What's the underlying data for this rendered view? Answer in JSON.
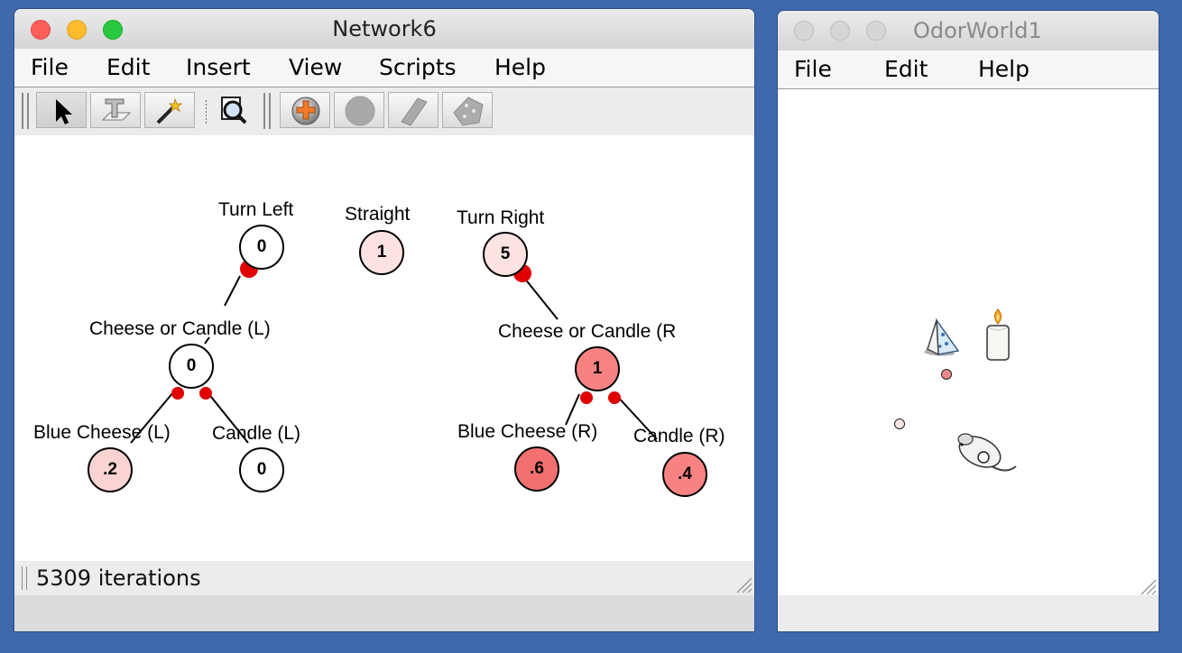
{
  "network_window": {
    "title": "Network6",
    "menu": [
      "File",
      "Edit",
      "Insert",
      "View",
      "Scripts",
      "Help"
    ],
    "toolbar": [
      "select-arrow-icon",
      "text-tool-icon",
      "wand-icon",
      "zoom-icon",
      "add-neuron-icon",
      "neuron-icon",
      "eraser-icon",
      "dice-icon"
    ],
    "neurons": [
      {
        "id": "turn-left",
        "label": "Turn Left",
        "value": "0",
        "color": "#ffffff"
      },
      {
        "id": "straight",
        "label": "Straight",
        "value": "1",
        "color": "#fde2e2"
      },
      {
        "id": "turn-right",
        "label": "Turn Right",
        "value": "5",
        "color": "#fde2e2"
      },
      {
        "id": "cheese-candle-left",
        "label": "Cheese or Candle (L)",
        "value": "0",
        "color": "#ffffff"
      },
      {
        "id": "cheese-candle-right",
        "label": "Cheese or Candle (R",
        "value": "1",
        "color": "#f88282"
      },
      {
        "id": "blue-cheese-left",
        "label": "Blue Cheese (L)",
        "value": ".2",
        "color": "#fbd3d3"
      },
      {
        "id": "candle-left",
        "label": "Candle (L)",
        "value": "0",
        "color": "#ffffff"
      },
      {
        "id": "blue-cheese-right",
        "label": "Blue Cheese (R)",
        "value": ".6",
        "color": "#f46f6f"
      },
      {
        "id": "candle-right",
        "label": "Candle (R)",
        "value": ".4",
        "color": "#f88282"
      }
    ],
    "status": "5309 iterations"
  },
  "odor_window": {
    "title": "OdorWorld1",
    "menu": [
      "File",
      "Edit",
      "Help"
    ],
    "objects": [
      "cheese-icon",
      "candle-icon",
      "mouse-icon"
    ]
  },
  "colors": {
    "desktop": "#3f68ad",
    "synapse": "#e00000",
    "close": "#fc5f57",
    "minimize": "#fdbc2e",
    "zoom": "#28c840"
  }
}
